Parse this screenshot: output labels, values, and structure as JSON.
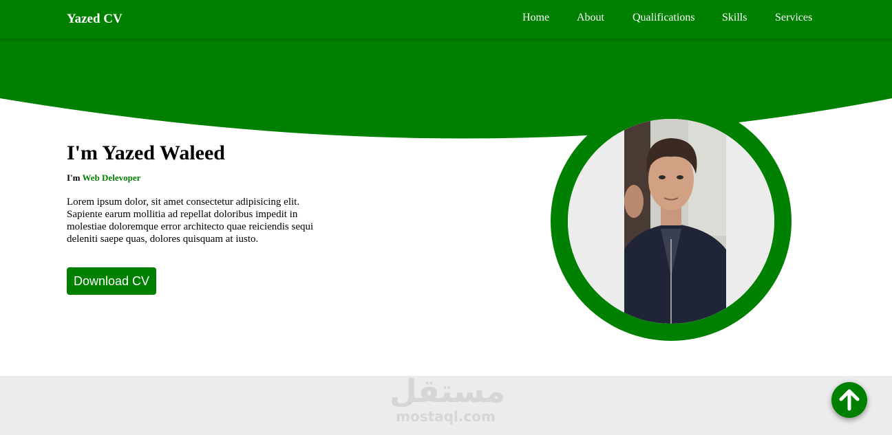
{
  "navbar": {
    "brand": "Yazed CV",
    "links": [
      "Home",
      "About",
      "Qualifications",
      "Skills",
      "Services"
    ]
  },
  "hero": {
    "title": "I'm Yazed Waleed",
    "subtitle_prefix": "I'm ",
    "subtitle_role": "Web Delevoper",
    "description": "Lorem ipsum dolor, sit amet consectetur adipisicing elit. Sapiente earum mollitia ad repellat doloribus impedit in molestiae doloremque error architecto quae reiciendis sequi deleniti saepe quas, dolores quisquam at iusto.",
    "download_label": "Download CV"
  },
  "watermark": {
    "arabic": "مستقل",
    "latin": "mostaql.com"
  },
  "colors": {
    "brand_green": "#008000",
    "footer_gray": "#ececec"
  },
  "icons": {
    "scroll_top": "arrow-up-icon"
  }
}
